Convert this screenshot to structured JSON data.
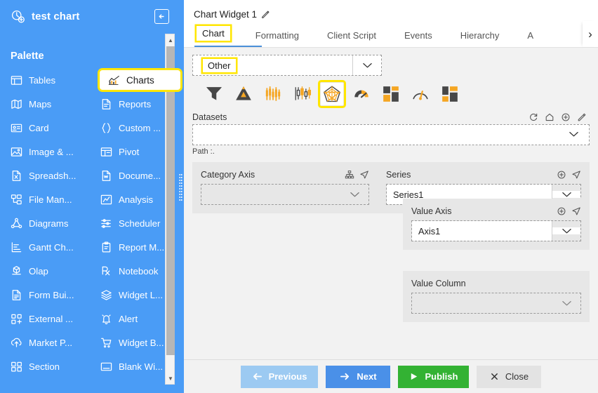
{
  "sidebar": {
    "logo_icon": "chart-add-icon",
    "title": "test chart",
    "back_icon": "arrow-left-boxed-icon",
    "palette_label": "Palette",
    "items": [
      {
        "label": "Tables",
        "icon": "table-icon",
        "highlighted": false
      },
      {
        "label": "Charts",
        "icon": "line-chart-icon",
        "highlighted": true
      },
      {
        "label": "Maps",
        "icon": "map-icon",
        "highlighted": false
      },
      {
        "label": "Reports",
        "icon": "report-icon",
        "highlighted": false
      },
      {
        "label": "Card",
        "icon": "card-icon",
        "highlighted": false
      },
      {
        "label": "Custom ...",
        "icon": "braces-icon",
        "highlighted": false
      },
      {
        "label": "Image & ...",
        "icon": "image-icon",
        "highlighted": false
      },
      {
        "label": "Pivot",
        "icon": "pivot-icon",
        "highlighted": false
      },
      {
        "label": "Spreadsh...",
        "icon": "spreadsheet-icon",
        "highlighted": false
      },
      {
        "label": "Docume...",
        "icon": "document-icon",
        "highlighted": false
      },
      {
        "label": "File Man...",
        "icon": "file-manager-icon",
        "highlighted": false
      },
      {
        "label": "Analysis",
        "icon": "analysis-icon",
        "highlighted": false
      },
      {
        "label": "Diagrams",
        "icon": "diagram-icon",
        "highlighted": false
      },
      {
        "label": "Scheduler",
        "icon": "scheduler-icon",
        "highlighted": false
      },
      {
        "label": "Gantt Ch...",
        "icon": "gantt-icon",
        "highlighted": false
      },
      {
        "label": "Report M...",
        "icon": "report-manager-icon",
        "highlighted": false
      },
      {
        "label": "Olap",
        "icon": "olap-icon",
        "highlighted": false
      },
      {
        "label": "Notebook",
        "icon": "notebook-icon",
        "highlighted": false
      },
      {
        "label": "Form Bui...",
        "icon": "form-builder-icon",
        "highlighted": false
      },
      {
        "label": "Widget L...",
        "icon": "widget-library-icon",
        "highlighted": false
      },
      {
        "label": "External ...",
        "icon": "external-icon",
        "highlighted": false
      },
      {
        "label": "Alert",
        "icon": "alert-bell-icon",
        "highlighted": false
      },
      {
        "label": "Market P...",
        "icon": "marketplace-icon",
        "highlighted": false
      },
      {
        "label": "Widget B...",
        "icon": "widget-basket-icon",
        "highlighted": false
      },
      {
        "label": "Section",
        "icon": "section-icon",
        "highlighted": false
      },
      {
        "label": "Blank Wi...",
        "icon": "blank-widget-icon",
        "highlighted": false
      }
    ],
    "scrollbar": {
      "up_icon": "scroll-up-icon",
      "down_icon": "scroll-down-icon"
    }
  },
  "header": {
    "widget_title": "Chart Widget 1",
    "edit_icon": "edit-pencil-icon",
    "tabs": [
      {
        "label": "Chart",
        "active": true
      },
      {
        "label": "Formatting",
        "active": false
      },
      {
        "label": "Client Script",
        "active": false
      },
      {
        "label": "Events",
        "active": false
      },
      {
        "label": "Hierarchy",
        "active": false
      },
      {
        "label": "A",
        "active": false
      }
    ],
    "next_tab_icon": "chevron-right-icon"
  },
  "chart_type": {
    "selected_group": "Other",
    "caret_icon": "chevron-down-icon",
    "icons": [
      {
        "name": "funnel-chart-icon",
        "selected": false
      },
      {
        "name": "pyramid-chart-icon",
        "selected": false
      },
      {
        "name": "candlestick-chart-icon",
        "selected": false
      },
      {
        "name": "boxplot-chart-icon",
        "selected": false
      },
      {
        "name": "radar-chart-icon",
        "selected": true
      },
      {
        "name": "gauge-chart-icon",
        "selected": false
      },
      {
        "name": "treemap-chart-icon",
        "selected": false
      },
      {
        "name": "speedometer-chart-icon",
        "selected": false
      },
      {
        "name": "treemap2-chart-icon",
        "selected": false
      }
    ]
  },
  "datasets": {
    "label": "Datasets",
    "value": "",
    "caret_icon": "chevron-down-icon",
    "path_label": "Path :.",
    "actions": [
      {
        "name": "refresh-icon"
      },
      {
        "name": "home-icon"
      },
      {
        "name": "add-icon"
      },
      {
        "name": "edit-icon"
      }
    ]
  },
  "category_axis": {
    "label": "Category Axis",
    "value": "",
    "caret_icon": "chevron-down-icon",
    "actions": [
      {
        "name": "hierarchy-icon"
      },
      {
        "name": "navigate-icon"
      }
    ]
  },
  "series": {
    "label": "Series",
    "value": "Series1",
    "caret_icon": "chevron-down-icon",
    "actions": [
      {
        "name": "add-icon"
      },
      {
        "name": "navigate-icon"
      }
    ]
  },
  "value_axis": {
    "label": "Value Axis",
    "value": "Axis1",
    "caret_icon": "chevron-down-icon",
    "actions": [
      {
        "name": "add-icon"
      },
      {
        "name": "navigate-icon"
      }
    ]
  },
  "value_column": {
    "label": "Value Column",
    "value": "",
    "caret_icon": "chevron-down-icon"
  },
  "footer": {
    "buttons": [
      {
        "label": "Previous",
        "icon": "arrow-left-icon",
        "style": "prev"
      },
      {
        "label": "Next",
        "icon": "arrow-right-icon",
        "style": "next"
      },
      {
        "label": "Publish",
        "icon": "play-icon",
        "style": "publish"
      },
      {
        "label": "Close",
        "icon": "close-x-icon",
        "style": "close"
      }
    ]
  },
  "colors": {
    "sidebar_blue": "#4a9cf6",
    "highlight_yellow": "#ffe600",
    "accent_orange": "#f5a623",
    "publish_green": "#33b233",
    "tab_underline": "#4a90d9"
  }
}
